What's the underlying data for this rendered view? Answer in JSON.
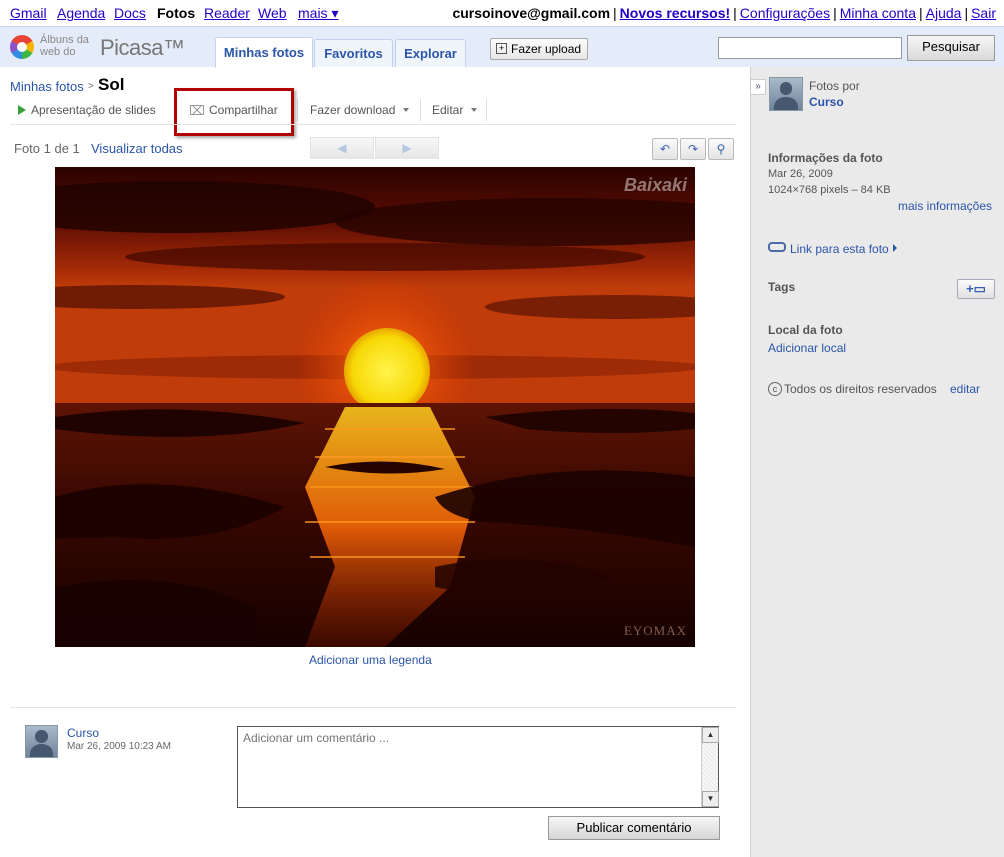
{
  "gbar": {
    "links": [
      "Gmail",
      "Agenda",
      "Docs",
      "Fotos",
      "Reader",
      "Web",
      "mais ▾"
    ],
    "email": "cursoinove@gmail.com",
    "new_features": "Novos recursos!",
    "settings": "Configurações",
    "account": "Minha conta",
    "help": "Ajuda",
    "signout": "Sair"
  },
  "header": {
    "logo_line1": "Álbuns da",
    "logo_line2": "web do",
    "logo_name": "Picasa™",
    "tabs": [
      "Minhas fotos",
      "Favoritos",
      "Explorar"
    ],
    "upload_label": "Fazer upload",
    "search_value": "",
    "search_button": "Pesquisar"
  },
  "breadcrumb": {
    "parent": "Minhas fotos",
    "separator": ">",
    "title": "Sol"
  },
  "toolbar": {
    "slideshow": "Apresentação de slides",
    "share": "Compartilhar",
    "download": "Fazer download",
    "edit": "Editar"
  },
  "photo_nav": {
    "counter": "Foto 1 de 1",
    "view_all": "Visualizar todas",
    "prev": "◀",
    "next": "▶"
  },
  "photo": {
    "watermark_top": "Baixaki",
    "watermark_bottom": "EYOMAX",
    "caption_link": "Adicionar uma legenda"
  },
  "comment": {
    "author": "Curso",
    "date": "Mar 26, 2009 10:23 AM",
    "placeholder": "Adicionar um comentário ...",
    "publish": "Publicar comentário"
  },
  "sidebar": {
    "photos_by": "Fotos por",
    "owner": "Curso",
    "info_heading": "Informações da foto",
    "date": "Mar 26, 2009",
    "dimensions": "1024×768 pixels – 84 KB",
    "more_info": "mais informações",
    "link_label": "Link para esta foto",
    "tags_heading": "Tags",
    "location_heading": "Local da foto",
    "add_location": "Adicionar local",
    "rights": "Todos os direitos reservados",
    "rights_edit": "editar"
  },
  "colors": {
    "link": "#2a55a8",
    "header_bg": "#e5ecf9",
    "sidebar_bg": "#eaeaea",
    "highlight": "#b00000"
  }
}
